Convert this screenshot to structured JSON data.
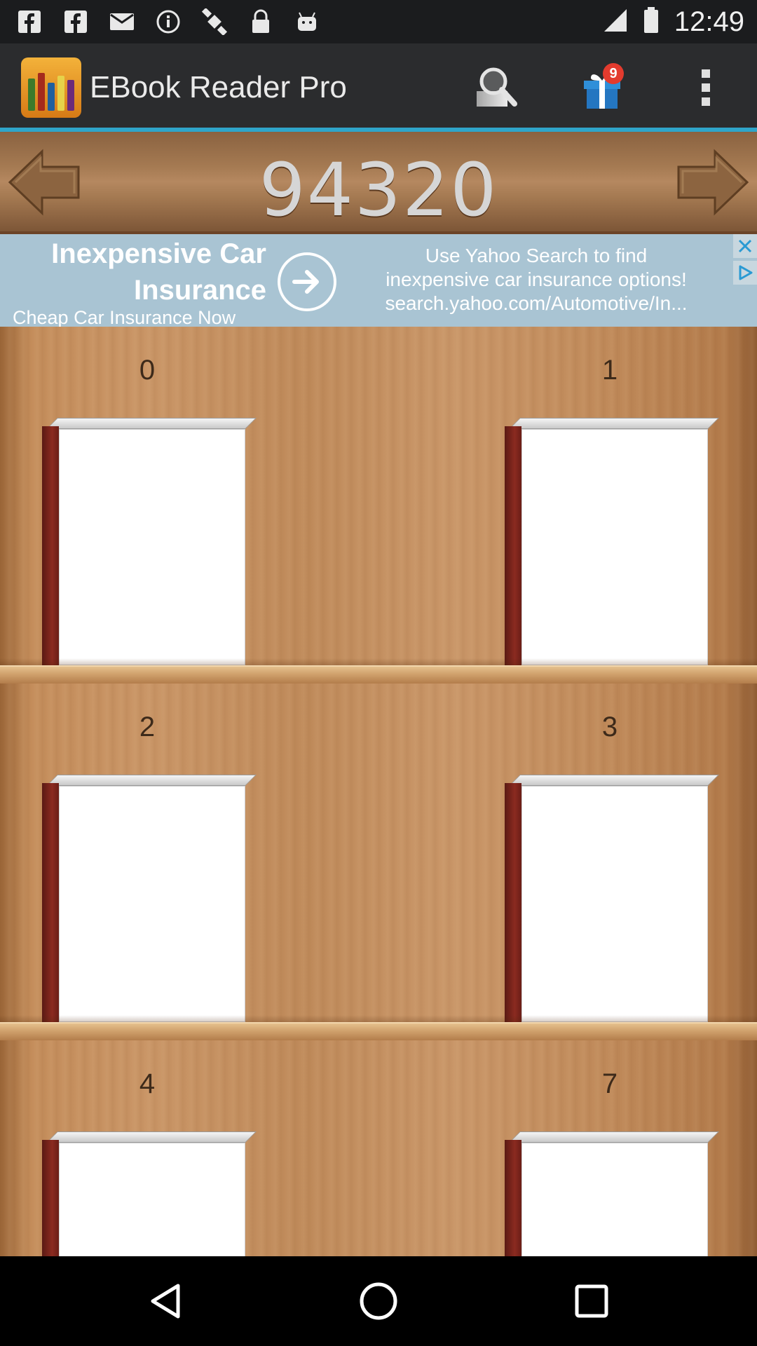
{
  "status_bar": {
    "time": "12:49",
    "left_icons": [
      "facebook-icon",
      "facebook-icon",
      "mail-icon",
      "info-icon",
      "gps-icon",
      "lock-icon",
      "android-icon"
    ],
    "right_icons": [
      "signal-icon",
      "battery-icon"
    ]
  },
  "action_bar": {
    "title": "EBook Reader Pro",
    "search_icon": "search-icon",
    "gift_icon": "gift-icon",
    "gift_badge": "9",
    "menu_icon": "overflow-menu-icon",
    "accent": "#2fa5c9"
  },
  "counter_bar": {
    "value": "94320"
  },
  "ad": {
    "headline": "Inexpensive Car Insurance",
    "headline_line1": "Inexpensive Car",
    "headline_line2": "Insurance",
    "subline": "Cheap Car Insurance Now",
    "body_line1": "Use Yahoo Search to find",
    "body_line2": "inexpensive car insurance options!",
    "body_line3": "search.yahoo.com/Automotive/In..."
  },
  "shelves": [
    {
      "left_label": "0",
      "right_label": "1"
    },
    {
      "left_label": "2",
      "right_label": "3"
    },
    {
      "left_label": "4",
      "right_label": "7"
    }
  ]
}
